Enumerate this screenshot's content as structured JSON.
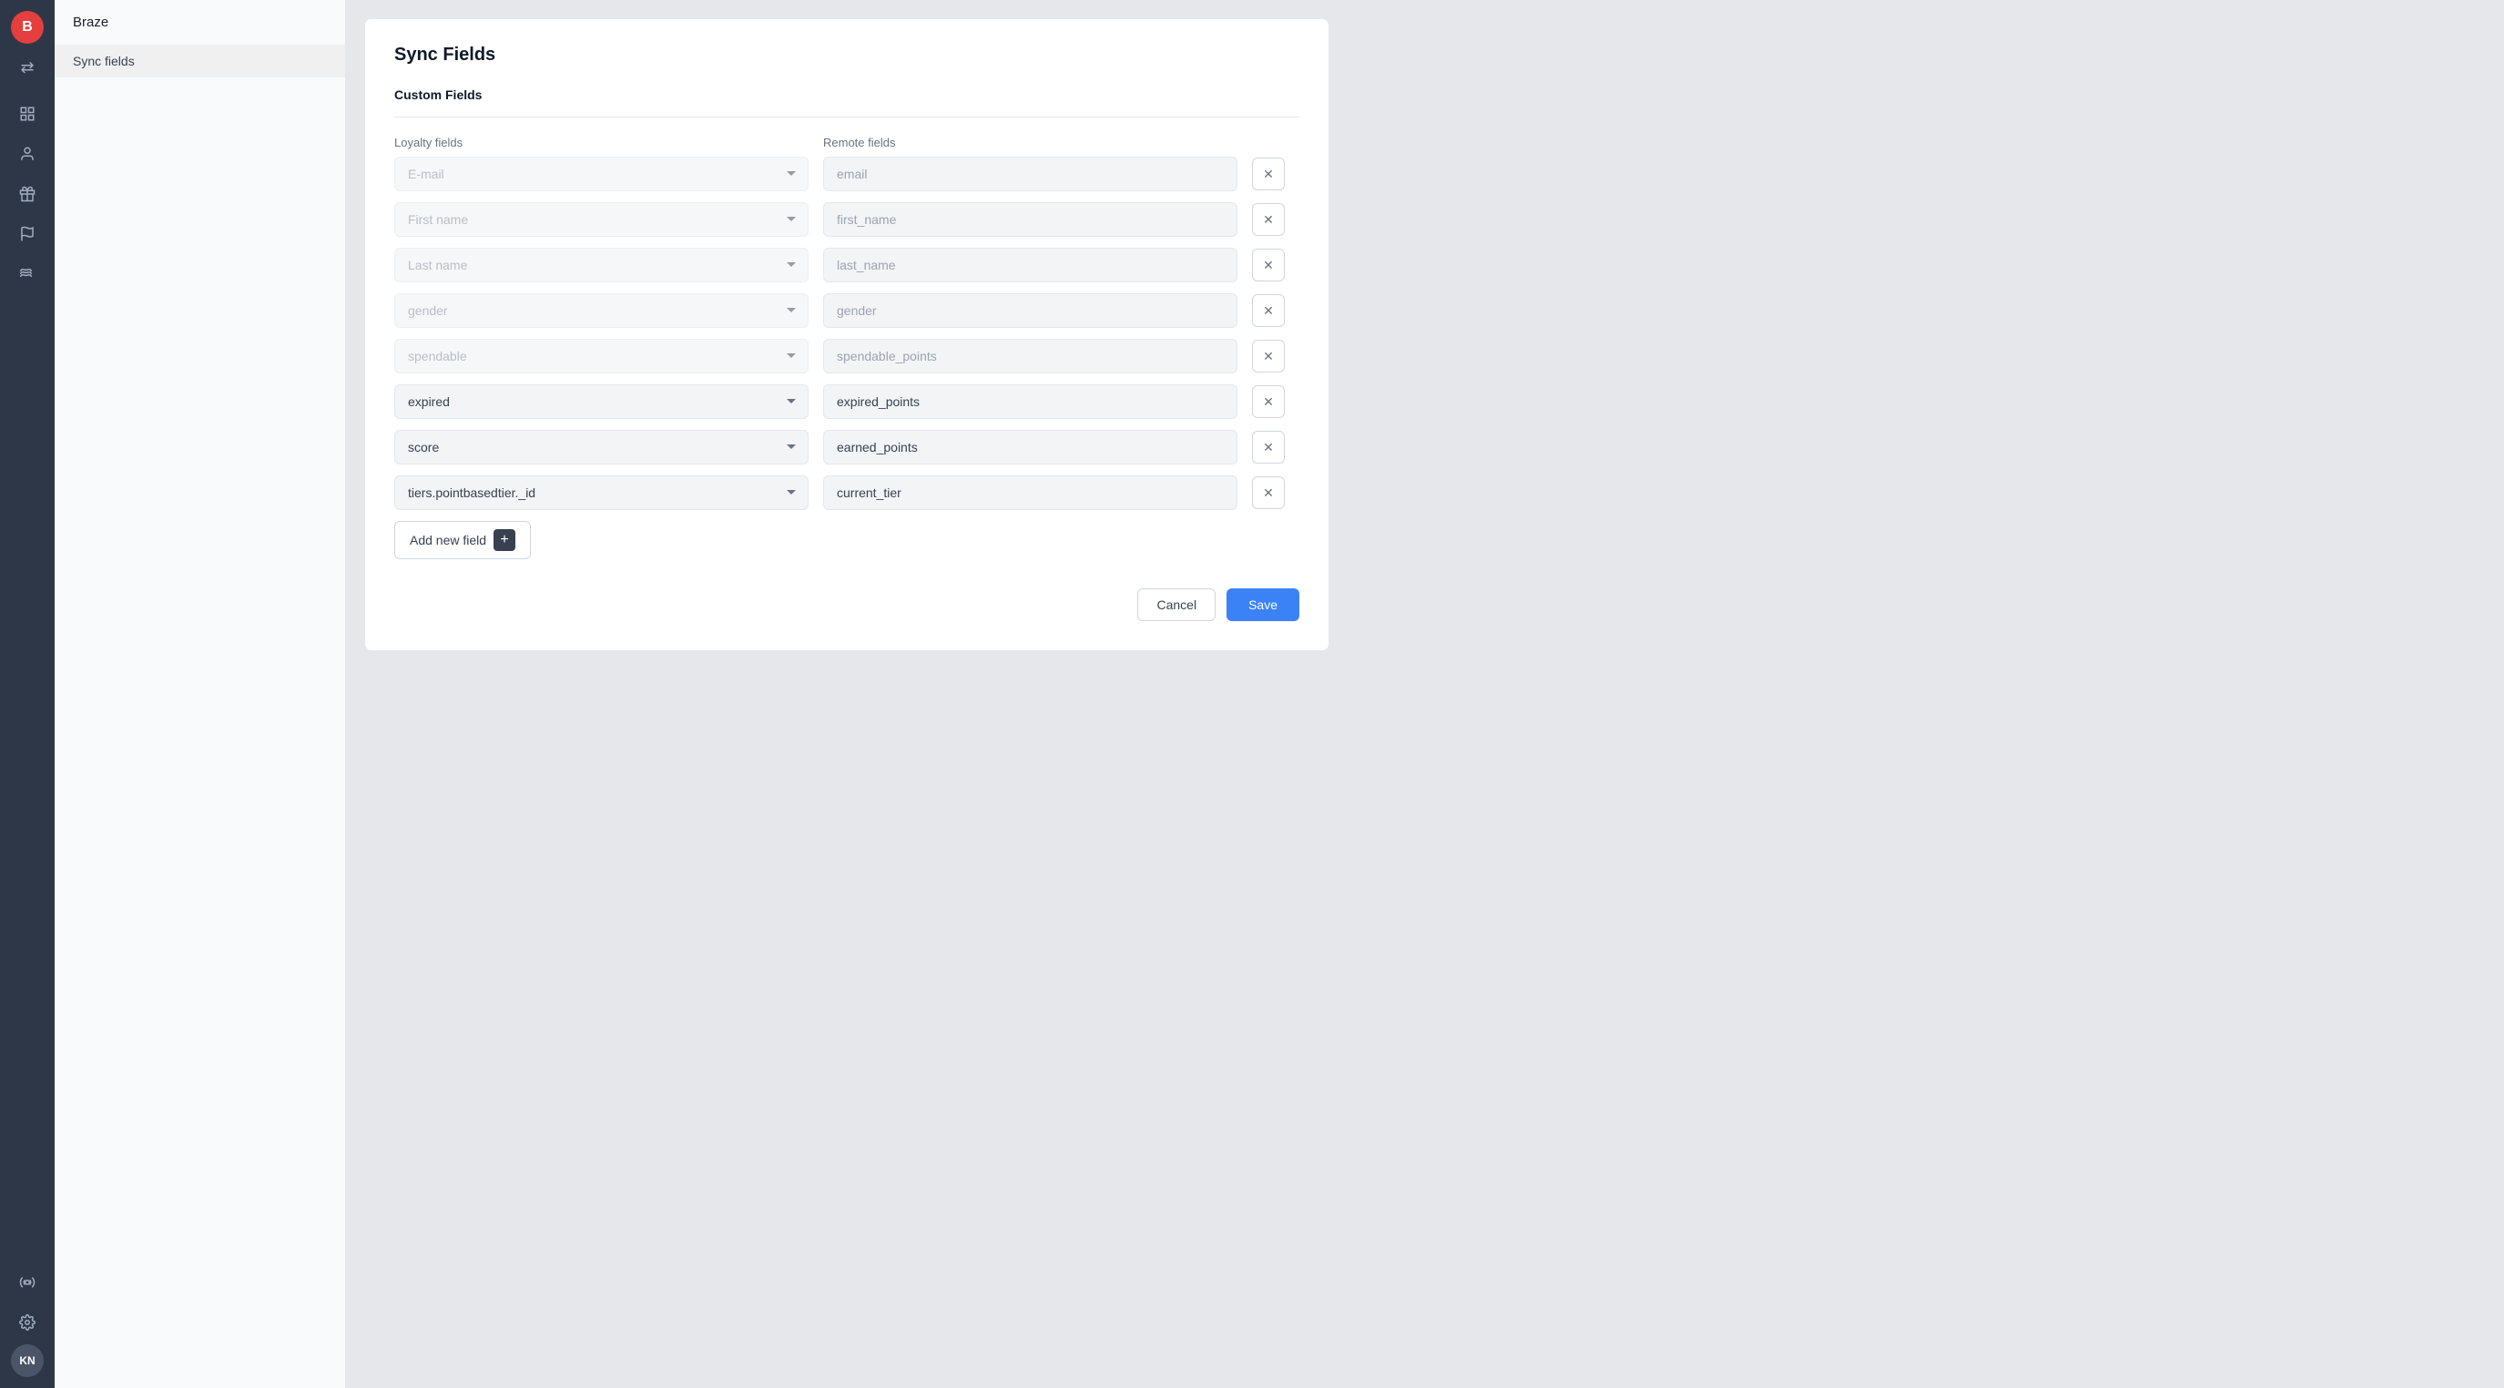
{
  "app": {
    "name": "Braze"
  },
  "sidebar": {
    "logo_text": "B",
    "avatar_initials": "KN",
    "nav_icons": [
      "chart-icon",
      "person-icon",
      "gift-icon",
      "flag-icon",
      "waves-icon"
    ],
    "bottom_icons": [
      "gear-cog-icon",
      "settings-icon"
    ]
  },
  "left_panel": {
    "item_label": "Sync fields"
  },
  "page": {
    "title": "Sync Fields",
    "section_title": "Custom Fields",
    "loyalty_fields_label": "Loyalty fields",
    "remote_fields_label": "Remote fields"
  },
  "fields": [
    {
      "id": 1,
      "loyalty": "E-mail",
      "remote": "email",
      "loyalty_disabled": true
    },
    {
      "id": 2,
      "loyalty": "First name",
      "remote": "first_name",
      "loyalty_disabled": true
    },
    {
      "id": 3,
      "loyalty": "Last name",
      "remote": "last_name",
      "loyalty_disabled": true
    },
    {
      "id": 4,
      "loyalty": "gender",
      "remote": "gender",
      "loyalty_disabled": true
    },
    {
      "id": 5,
      "loyalty": "spendable",
      "remote": "spendable_points",
      "loyalty_disabled": true
    },
    {
      "id": 6,
      "loyalty": "expired",
      "remote": "expired_points",
      "loyalty_disabled": false
    },
    {
      "id": 7,
      "loyalty": "score",
      "remote": "earned_points",
      "loyalty_disabled": false
    },
    {
      "id": 8,
      "loyalty": "tiers.pointbasedtier._id",
      "remote": "current_tier",
      "loyalty_disabled": false
    }
  ],
  "buttons": {
    "add_new_field": "Add new field",
    "cancel": "Cancel",
    "save": "Save"
  }
}
